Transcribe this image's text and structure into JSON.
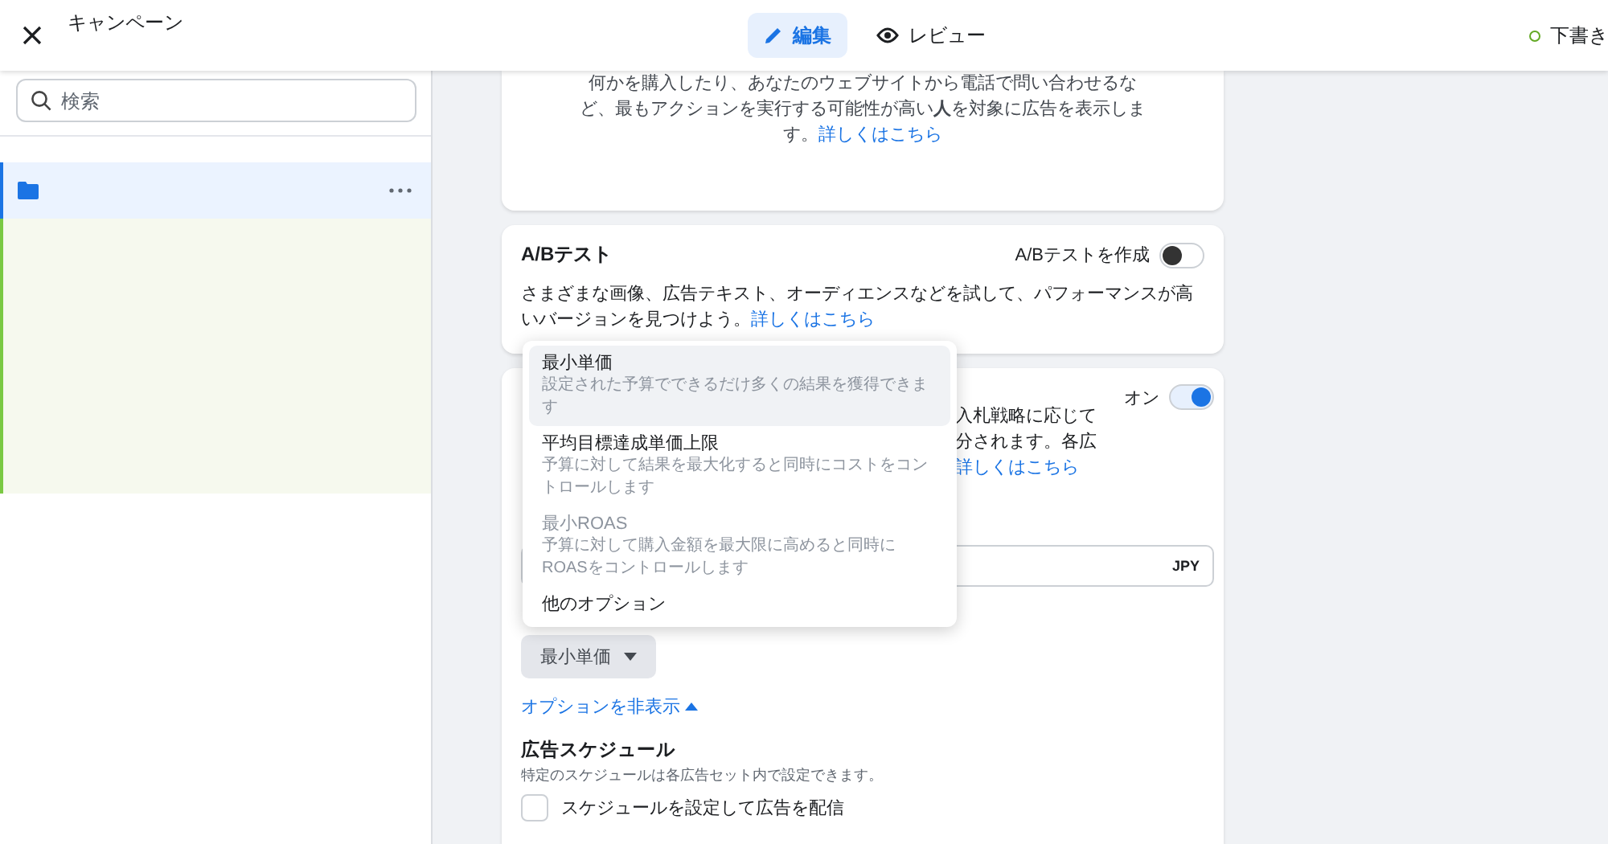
{
  "header": {
    "title": "キャンペーン",
    "tabs": [
      {
        "label": "編集",
        "selected": true
      },
      {
        "label": "レビュー",
        "selected": false
      }
    ],
    "status": "下書き"
  },
  "sidebar": {
    "search": {
      "placeholder": "検索"
    },
    "items": [
      {
        "selected": true
      }
    ]
  },
  "objective_card": {
    "lines": [
      "何かを購入したり、あなたのウェブサイトから電話で問い合わせるな",
      "ど、最もアクションを実行する可能性が高い**人**を対象に広告を表示しま",
      "す。"
    ],
    "link": "詳しくはこちら"
  },
  "ab_test_card": {
    "title": "A/Bテスト",
    "toggle_label": "A/Bテストを作成",
    "on": false,
    "description": "さまざまな画像、広告テキスト、オーディエンスなどを試して、パフォーマンスが高いバージョンを見つけよう。",
    "link": "詳しくはこちら"
  },
  "budget_card": {
    "toggle_label": "オン",
    "on": true,
    "lines": [
      "入札戦略に応じて",
      "分されます。各広"
    ],
    "link": "詳しくはこちら",
    "currency": "JPY",
    "bid_strategy": "最小単価",
    "options_link": "オプションを非表示",
    "schedule": {
      "title": "広告スケジュール",
      "note": "特定のスケジュールは各広告セット内で設定できます。",
      "checkbox": {
        "label": "スケジュールを設定して広告を配信",
        "checked": false
      }
    }
  },
  "dropdown": {
    "options": [
      {
        "title": "最小単価",
        "description": "設定された予算でできるだけ多くの結果を獲得できます",
        "selected": true,
        "disabled": false
      },
      {
        "title": "平均目標達成単価上限",
        "description": "予算に対して結果を最大化すると同時にコストをコントロールします",
        "selected": false,
        "disabled": false
      },
      {
        "title": "最小ROAS",
        "description": "予算に対して購入金額を最大限に高めると同時にROASをコントロールします",
        "selected": false,
        "disabled": true
      },
      {
        "title": "他のオプション",
        "selected": false,
        "disabled": false
      }
    ]
  }
}
